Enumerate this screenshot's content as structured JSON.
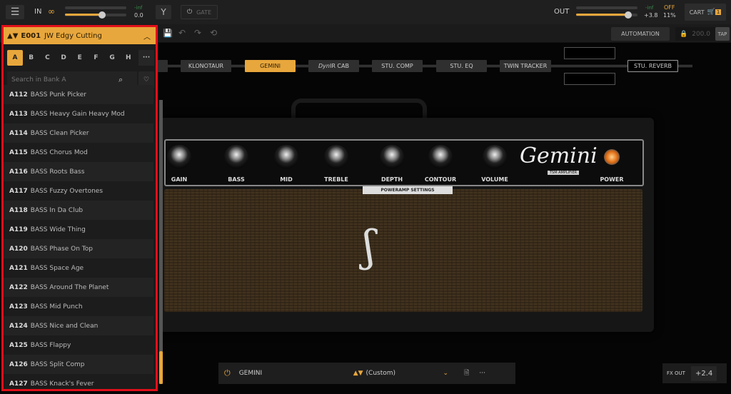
{
  "topbar": {
    "in_label": "IN",
    "in_peak": "-inf",
    "in_value": "0.0",
    "in_level": 0.6,
    "gate_label": "GATE",
    "out_label": "OUT",
    "out_peak": "-inf",
    "out_value": "+3.8",
    "out_level": 0.85,
    "cpu_state": "OFF",
    "cpu_percent": "11%",
    "cart_label": "CART",
    "cart_count": "1",
    "accent": "#e8a73c"
  },
  "toolbar": {
    "automation_label": "AUTOMATION",
    "bpm": "200.0",
    "tap_label": "TAP"
  },
  "chain": [
    "KLONOTAUR",
    "GEMINI",
    "STU. COMP",
    "STU. EQ",
    "TWIN TRACKER",
    "STU. REVERB"
  ],
  "chain_cab": {
    "italic": "Dyn",
    "rest": "IR CAB"
  },
  "preset_panel": {
    "id": "E001",
    "name": "JW Edgy Cutting",
    "banks": [
      "A",
      "B",
      "C",
      "D",
      "E",
      "F",
      "G",
      "H"
    ],
    "active_bank": "A",
    "search_placeholder": "Search in Bank A",
    "presets": [
      {
        "id": "A112",
        "name": "BASS Punk Picker"
      },
      {
        "id": "A113",
        "name": "BASS Heavy Gain Heavy Mod"
      },
      {
        "id": "A114",
        "name": "BASS Clean Picker"
      },
      {
        "id": "A115",
        "name": "BASS Chorus Mod"
      },
      {
        "id": "A116",
        "name": "BASS Roots Bass"
      },
      {
        "id": "A117",
        "name": "BASS Fuzzy Overtones"
      },
      {
        "id": "A118",
        "name": "BASS In Da Club"
      },
      {
        "id": "A119",
        "name": "BASS Wide Thing"
      },
      {
        "id": "A120",
        "name": "BASS Phase On Top"
      },
      {
        "id": "A121",
        "name": "BASS Space Age"
      },
      {
        "id": "A122",
        "name": "BASS Around The Planet"
      },
      {
        "id": "A123",
        "name": "BASS Mid Punch"
      },
      {
        "id": "A124",
        "name": "BASS Nice and Clean"
      },
      {
        "id": "A125",
        "name": "BASS Flappy"
      },
      {
        "id": "A126",
        "name": "BASS Split Comp"
      },
      {
        "id": "A127",
        "name": "BASS Knack's Fever"
      }
    ]
  },
  "amp": {
    "knobs": [
      "GAIN",
      "BASS",
      "MID",
      "TREBLE",
      "DEPTH",
      "CONTOUR",
      "VOLUME"
    ],
    "power_label": "POWER",
    "poweramp_label": "POWERAMP SETTINGS",
    "logo": "Gemini",
    "logo_sub": "TSM AMPLIFIER"
  },
  "bottom": {
    "module": "GEMINI",
    "preset": "(Custom)",
    "fx_out_label": "FX OUT",
    "fx_out_value": "+2.4"
  }
}
